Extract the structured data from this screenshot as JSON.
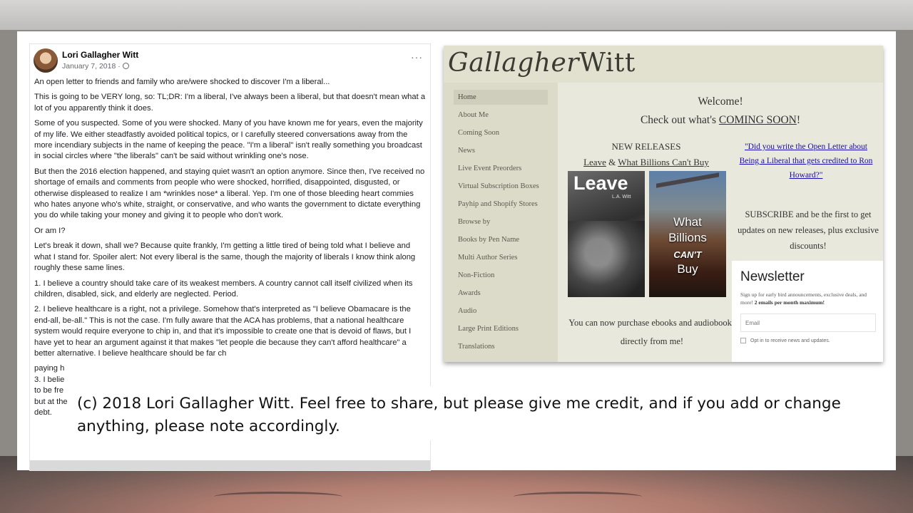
{
  "post": {
    "author": "Lori Gallagher Witt",
    "date": "January 7, 2018 ·",
    "more_label": "···",
    "paragraphs": [
      "An open letter to friends and family who are/were shocked to discover I'm a liberal...",
      "This is going to be VERY long, so: TL;DR: I'm a liberal, I've always been a liberal, but that doesn't mean what a lot of you apparently think it does.",
      "Some of you suspected. Some of you were shocked. Many of you have known me for years, even the majority of my life. We either steadfastly avoided political topics, or I carefully steered conversations away from the more incendiary subjects in the name of keeping the peace. \"I'm a liberal\" isn't really something you broadcast in social circles where \"the liberals\" can't be said without wrinkling one's nose.",
      "But then the 2016 election happened, and staying quiet wasn't an option anymore. Since then, I've received no shortage of emails and comments from people who were shocked, horrified, disappointed, disgusted, or otherwise displeased to realize I am *wrinkles nose* a liberal. Yep. I'm one of those bleeding heart commies who hates anyone who's white, straight, or conservative, and who wants the government to dictate everything you do while taking your money and giving it to people who don't work.",
      "Or am I?",
      "Let's break it down, shall we? Because quite frankly, I'm getting a little tired of being told what I believe and what I stand for. Spoiler alert: Not every liberal is the same, though the majority of liberals I know think along roughly these same lines.",
      "1. I believe a country should take care of its weakest members. A country cannot call itself civilized when its children, disabled, sick, and elderly are neglected. Period.",
      "2. I believe healthcare is a right, not a privilege. Somehow that's interpreted as \"I believe Obamacare is the end-all, be-all.\" This is not the case. I'm fully aware that the ACA has problems, that a national healthcare system would require everyone to chip in, and that it's impossible to create one that is devoid of flaws, but I have yet to hear an argument against it that makes \"let people die because they can't afford healthcare\" a better alternative. I believe healthcare should be far ch",
      "paying h",
      "3. I belie",
      "to be fre",
      "but at the end of the day, there is no excuse for students graduating college saddled with five- or six-figure debt."
    ]
  },
  "site": {
    "logo_script": "Gallagher",
    "logo_plain": "Witt",
    "nav": [
      "Home",
      "About Me",
      "Coming Soon",
      "News",
      "Live Event Preorders",
      "Virtual Subscription Boxes",
      "Payhip and Shopify Stores",
      "Browse by",
      "Books by Pen Name",
      "Multi Author Series",
      "Non-Fiction",
      "Awards",
      "Audio",
      "Large Print Editions",
      "Translations"
    ],
    "welcome": "Welcome!",
    "check_out_prefix": "Check out what's ",
    "coming_soon": "COMING SOON",
    "check_out_suffix": "!",
    "new_releases": "NEW RELEASES",
    "release_1": "Leave",
    "release_amp": " & ",
    "release_2": "What Billions Can't Buy",
    "book1_title": "Leave",
    "book1_author": "L.A. Witt",
    "book2_line1": "What",
    "book2_line2": "Billions",
    "book2_line3": "CAN'T",
    "book2_line4": "Buy",
    "purchase": "You can now purchase ebooks and audiobooks directly from me!",
    "ron_link": "\"Did you write the Open Letter about Being a Liberal that gets credited to Ron Howard?\"",
    "subscribe": "SUBSCRIBE and be the first to get updates on new releases, plus exclusive discounts!"
  },
  "newsletter": {
    "title": "Newsletter",
    "desc": "Sign up for early bird announcements, exclusive deals, and more! ",
    "desc_bold": "2 emails per month maximum!",
    "email_placeholder": "Email",
    "opt_in": "Opt in to receive news and updates."
  },
  "caption": "(c) 2018 Lori Gallagher Witt. Feel free to share, but please give me credit, and if you add or change anything, please note accordingly."
}
